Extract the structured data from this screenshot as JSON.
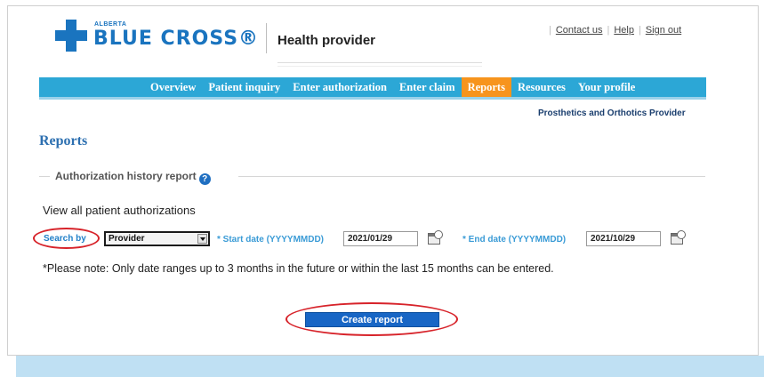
{
  "logo": {
    "top_text": "ALBERTA",
    "main_text": "BLUE CROSS®"
  },
  "header": {
    "subtitle": "Health provider",
    "links": [
      {
        "label": "Contact us"
      },
      {
        "label": "Help"
      },
      {
        "label": "Sign out"
      }
    ]
  },
  "nav": {
    "items": [
      {
        "label": "Overview"
      },
      {
        "label": "Patient inquiry"
      },
      {
        "label": "Enter authorization"
      },
      {
        "label": "Enter claim"
      },
      {
        "label": "Reports"
      },
      {
        "label": "Resources"
      },
      {
        "label": "Your profile"
      }
    ],
    "active_index": 4,
    "sub_label": "Prosthetics and Orthotics Provider"
  },
  "page": {
    "title": "Reports",
    "section_title": "Authorization history report",
    "view_all": "View all patient authorizations",
    "search_by_label": "Search by",
    "search_by_value": "Provider",
    "start_label": "* Start date (YYYYMMDD)",
    "start_value": "2021/01/29",
    "end_label": "* End date (YYYYMMDD)",
    "end_value": "2021/10/29",
    "note": "*Please note: Only date ranges up to 3 months in the future or within the last 15 months can be entered.",
    "create_button": "Create report"
  },
  "colors": {
    "brand_blue": "#1a74bf",
    "nav_bg": "#2ca7d6",
    "nav_active": "#f7941d",
    "highlight_oval": "#d7232a",
    "button": "#1866c5"
  }
}
